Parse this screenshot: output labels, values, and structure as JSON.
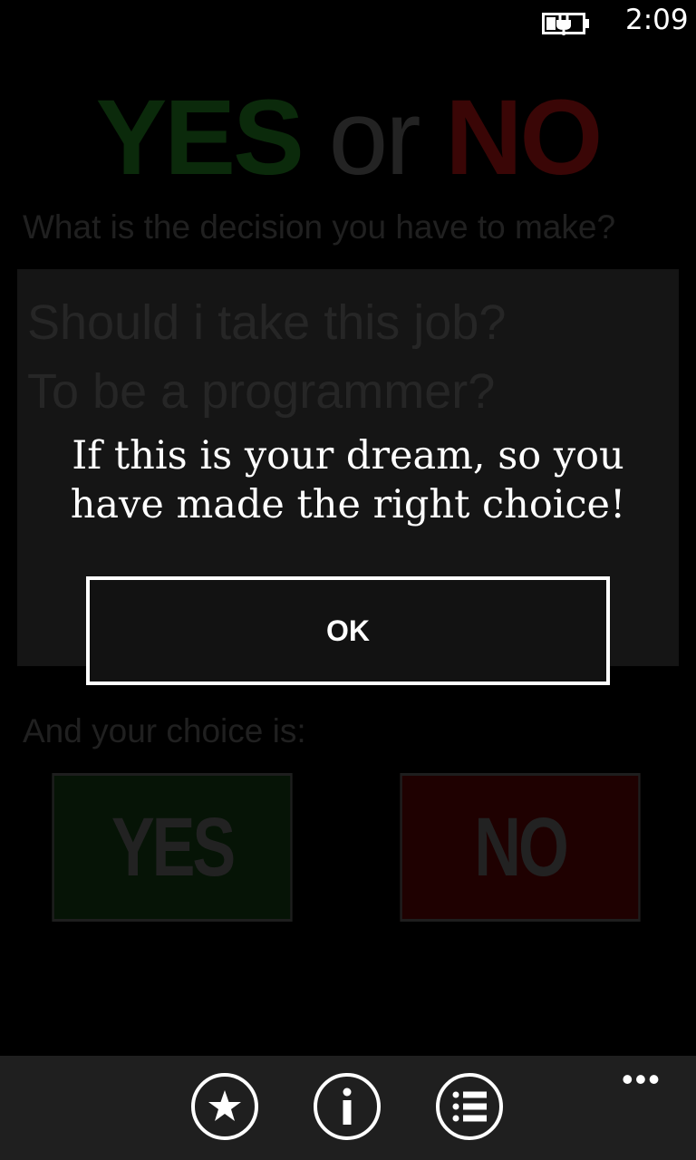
{
  "status_bar": {
    "time": "2:09",
    "battery_icon": "battery-charging-icon"
  },
  "app": {
    "title_yes": "YES",
    "title_or": "or",
    "title_no": "NO",
    "question_label": "What is the decision you have to make?",
    "decision_text": "Should i take this job?\nTo be a programmer?",
    "choice_label": "And your choice is:",
    "yes_button": "YES",
    "no_button": "NO"
  },
  "dialog": {
    "message": "If this is your dream, so you have made the right choice!",
    "ok_label": "OK"
  },
  "app_bar": {
    "buttons": [
      {
        "icon": "star-icon"
      },
      {
        "icon": "info-icon"
      },
      {
        "icon": "list-icon"
      }
    ],
    "more": "•••"
  },
  "colors": {
    "yes_dim": "#0b2a0b",
    "no_dim": "#3a0606",
    "dialog_bg": "#121212",
    "appbar_bg": "#1f1f1f"
  }
}
